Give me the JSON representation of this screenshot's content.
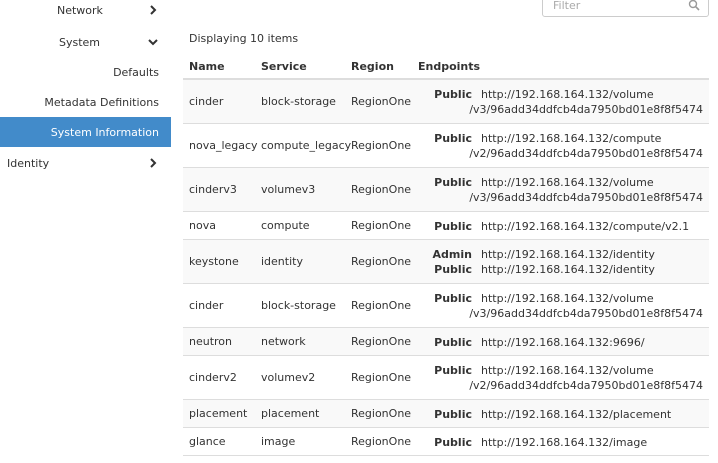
{
  "sidebar": {
    "network": "Network",
    "system": "System",
    "defaults": "Defaults",
    "metadata": "Metadata Definitions",
    "system_info": "System Information",
    "identity": "Identity"
  },
  "filter": {
    "placeholder": "Filter"
  },
  "count_text": "Displaying 10 items",
  "table": {
    "headers": {
      "name": "Name",
      "service": "Service",
      "region": "Region",
      "endpoints": "Endpoints"
    },
    "rows": [
      {
        "name": "cinder",
        "service": "block-storage",
        "region": "RegionOne",
        "endpoints": [
          {
            "type": "Public",
            "url": "http://192.168.164.132/volume"
          },
          {
            "type": "",
            "url": "/v3/96add34ddfcb4da7950bd01e8f8f5474"
          }
        ]
      },
      {
        "name": "nova_legacy",
        "service": "compute_legacy",
        "region": "RegionOne",
        "endpoints": [
          {
            "type": "Public",
            "url": "http://192.168.164.132/compute"
          },
          {
            "type": "",
            "url": "/v2/96add34ddfcb4da7950bd01e8f8f5474"
          }
        ]
      },
      {
        "name": "cinderv3",
        "service": "volumev3",
        "region": "RegionOne",
        "endpoints": [
          {
            "type": "Public",
            "url": "http://192.168.164.132/volume"
          },
          {
            "type": "",
            "url": "/v3/96add34ddfcb4da7950bd01e8f8f5474"
          }
        ]
      },
      {
        "name": "nova",
        "service": "compute",
        "region": "RegionOne",
        "endpoints": [
          {
            "type": "Public",
            "url": "http://192.168.164.132/compute/v2.1"
          }
        ]
      },
      {
        "name": "keystone",
        "service": "identity",
        "region": "RegionOne",
        "endpoints": [
          {
            "type": "Admin",
            "url": "http://192.168.164.132/identity"
          },
          {
            "type": "Public",
            "url": "http://192.168.164.132/identity"
          }
        ]
      },
      {
        "name": "cinder",
        "service": "block-storage",
        "region": "RegionOne",
        "endpoints": [
          {
            "type": "Public",
            "url": "http://192.168.164.132/volume"
          },
          {
            "type": "",
            "url": "/v3/96add34ddfcb4da7950bd01e8f8f5474"
          }
        ]
      },
      {
        "name": "neutron",
        "service": "network",
        "region": "RegionOne",
        "endpoints": [
          {
            "type": "Public",
            "url": "http://192.168.164.132:9696/"
          }
        ]
      },
      {
        "name": "cinderv2",
        "service": "volumev2",
        "region": "RegionOne",
        "endpoints": [
          {
            "type": "Public",
            "url": "http://192.168.164.132/volume"
          },
          {
            "type": "",
            "url": "/v2/96add34ddfcb4da7950bd01e8f8f5474"
          }
        ]
      },
      {
        "name": "placement",
        "service": "placement",
        "region": "RegionOne",
        "endpoints": [
          {
            "type": "Public",
            "url": "http://192.168.164.132/placement"
          }
        ]
      },
      {
        "name": "glance",
        "service": "image",
        "region": "RegionOne",
        "endpoints": [
          {
            "type": "Public",
            "url": "http://192.168.164.132/image"
          }
        ]
      }
    ]
  },
  "colors": {
    "active_nav": "#428bca",
    "border": "#dddddd",
    "stripe": "#f9f9f9"
  }
}
